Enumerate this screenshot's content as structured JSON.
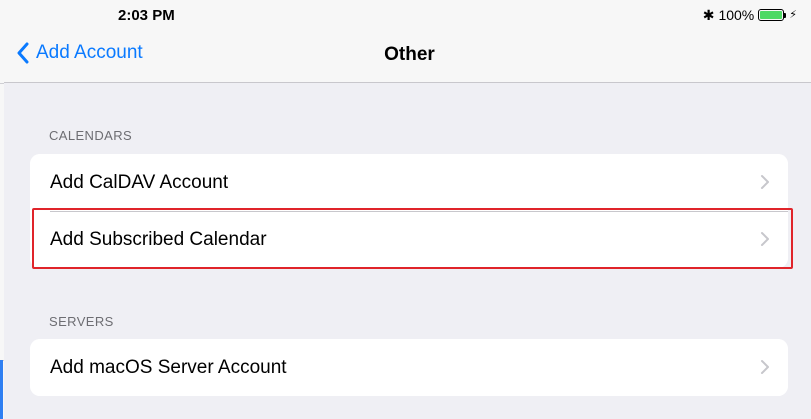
{
  "status_bar": {
    "time": "2:03 PM",
    "bluetooth_icon": "bluetooth-icon",
    "battery_percent": "100%",
    "battery_level": 1.0,
    "battery_color": "#4cd964",
    "charging_icon": "bolt-icon"
  },
  "nav": {
    "back_label": "Add Account",
    "back_icon": "chevron-left-icon",
    "title": "Other"
  },
  "sections": [
    {
      "header": "CALENDARS",
      "rows": [
        {
          "label": "Add CalDAV Account"
        },
        {
          "label": "Add Subscribed Calendar",
          "highlighted": true
        }
      ]
    },
    {
      "header": "SERVERS",
      "rows": [
        {
          "label": "Add macOS Server Account"
        }
      ]
    }
  ],
  "colors": {
    "accent": "#0a7aff",
    "highlight_border": "#e0242a",
    "background": "#efeff4"
  }
}
